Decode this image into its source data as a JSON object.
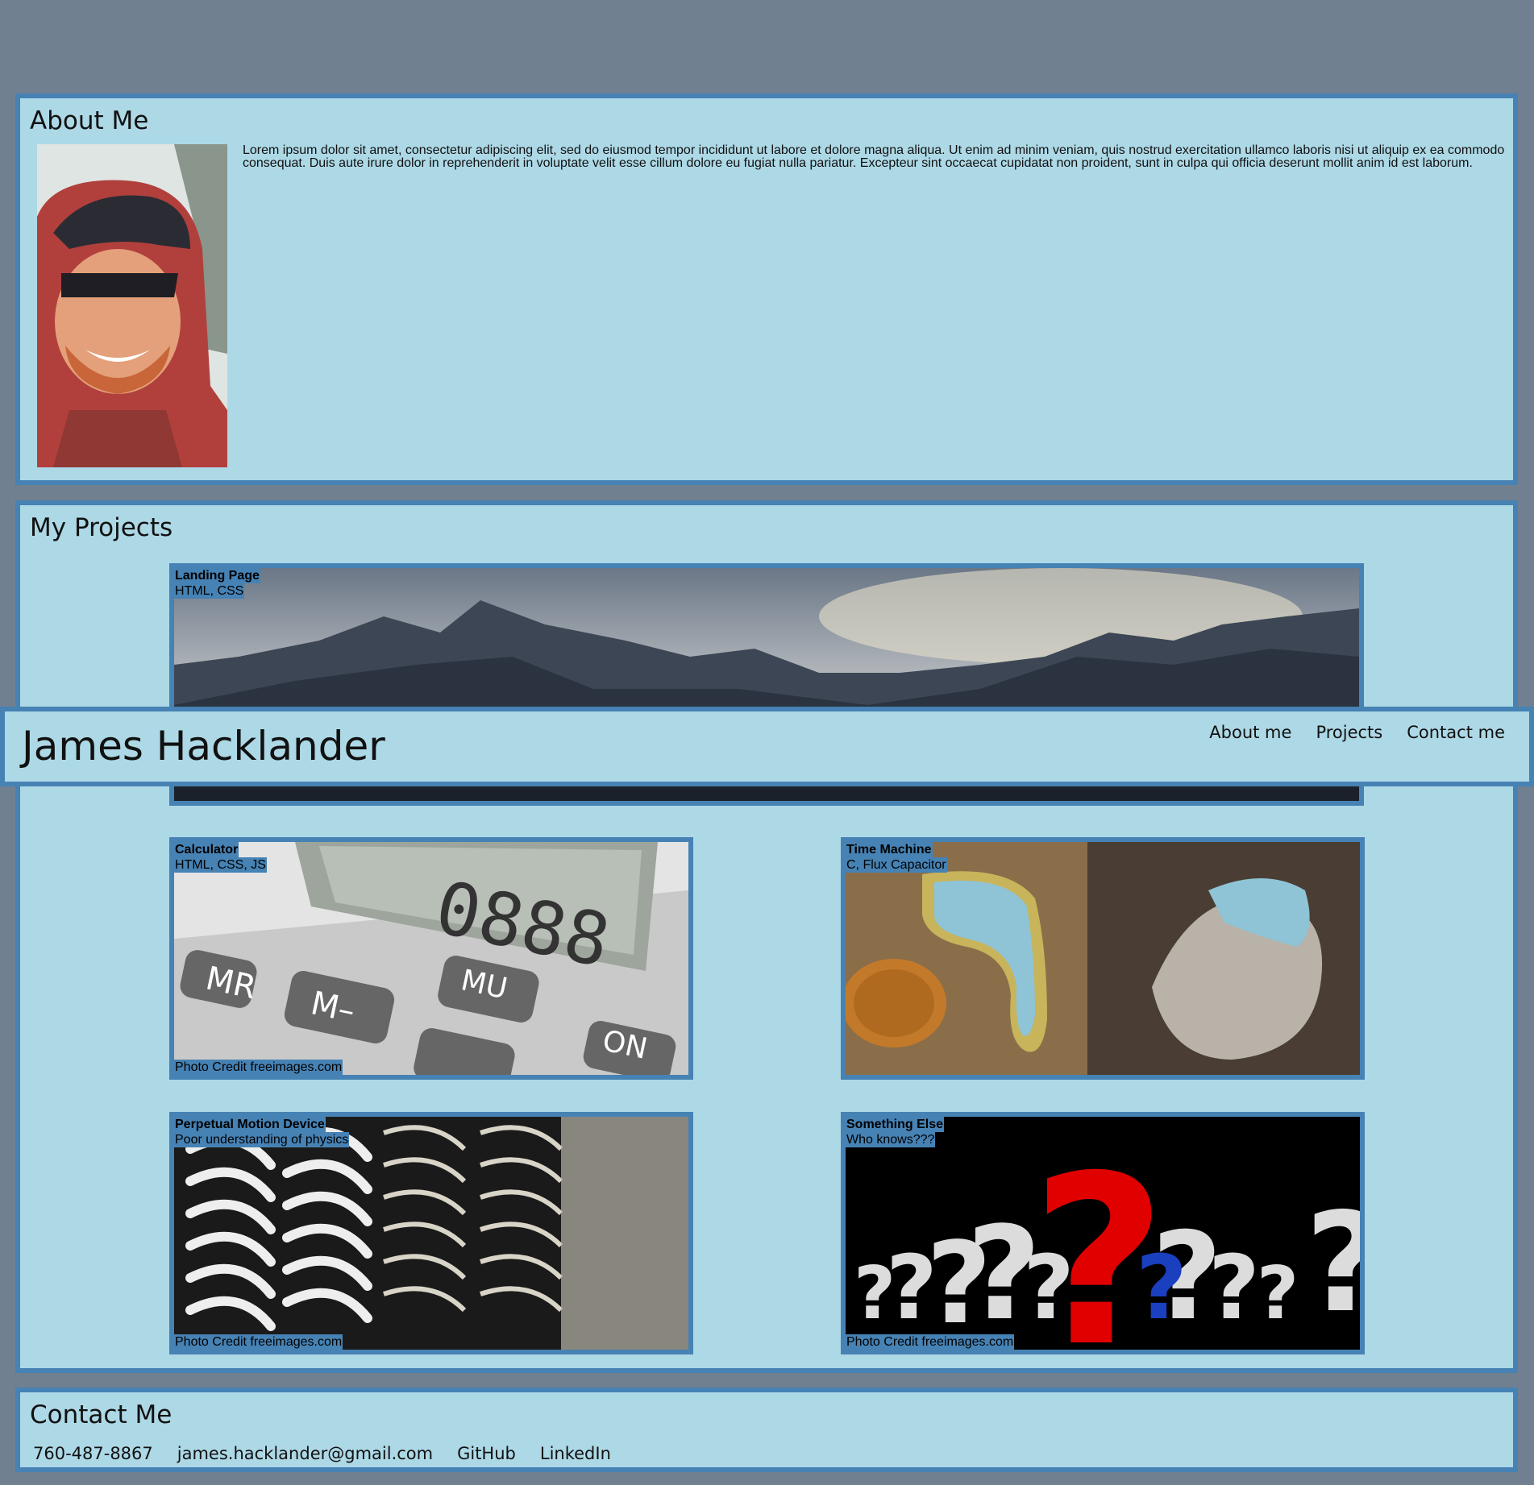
{
  "header": {
    "name": "James Hacklander",
    "nav": [
      "About me",
      "Projects",
      "Contact me"
    ]
  },
  "about": {
    "heading": "About Me",
    "text": "Lorem ipsum dolor sit amet, consectetur adipiscing elit, sed do eiusmod tempor incididunt ut labore et dolore magna aliqua. Ut enim ad minim veniam, quis nostrud exercitation ullamco laboris nisi ut aliquip ex ea commodo consequat. Duis aute irure dolor in reprehenderit in voluptate velit esse cillum dolore eu fugiat nulla pariatur. Excepteur sint occaecat cupidatat non proident, sunt in culpa qui officia deserunt mollit anim id est laborum."
  },
  "projects": {
    "heading": "My Projects",
    "items": [
      {
        "title": "Landing Page",
        "tech": "HTML, CSS",
        "credit": ""
      },
      {
        "title": "Calculator",
        "tech": "HTML, CSS, JS",
        "credit": "Photo Credit freeimages.com"
      },
      {
        "title": "Time Machine",
        "tech": "C, Flux Capacitor",
        "credit": ""
      },
      {
        "title": "Perpetual Motion Device",
        "tech": "Poor understanding of physics",
        "credit": "Photo Credit freeimages.com"
      },
      {
        "title": "Something Else",
        "tech": "Who knows???",
        "credit": "Photo Credit freeimages.com"
      }
    ]
  },
  "contact": {
    "heading": "Contact Me",
    "phone": "760-487-8867",
    "email": "james.hacklander@gmail.com",
    "github": "GitHub",
    "linkedin": "LinkedIn"
  },
  "colors": {
    "page_bg": "#708090",
    "panel_bg": "#add8e6",
    "border": "#4682b4"
  }
}
